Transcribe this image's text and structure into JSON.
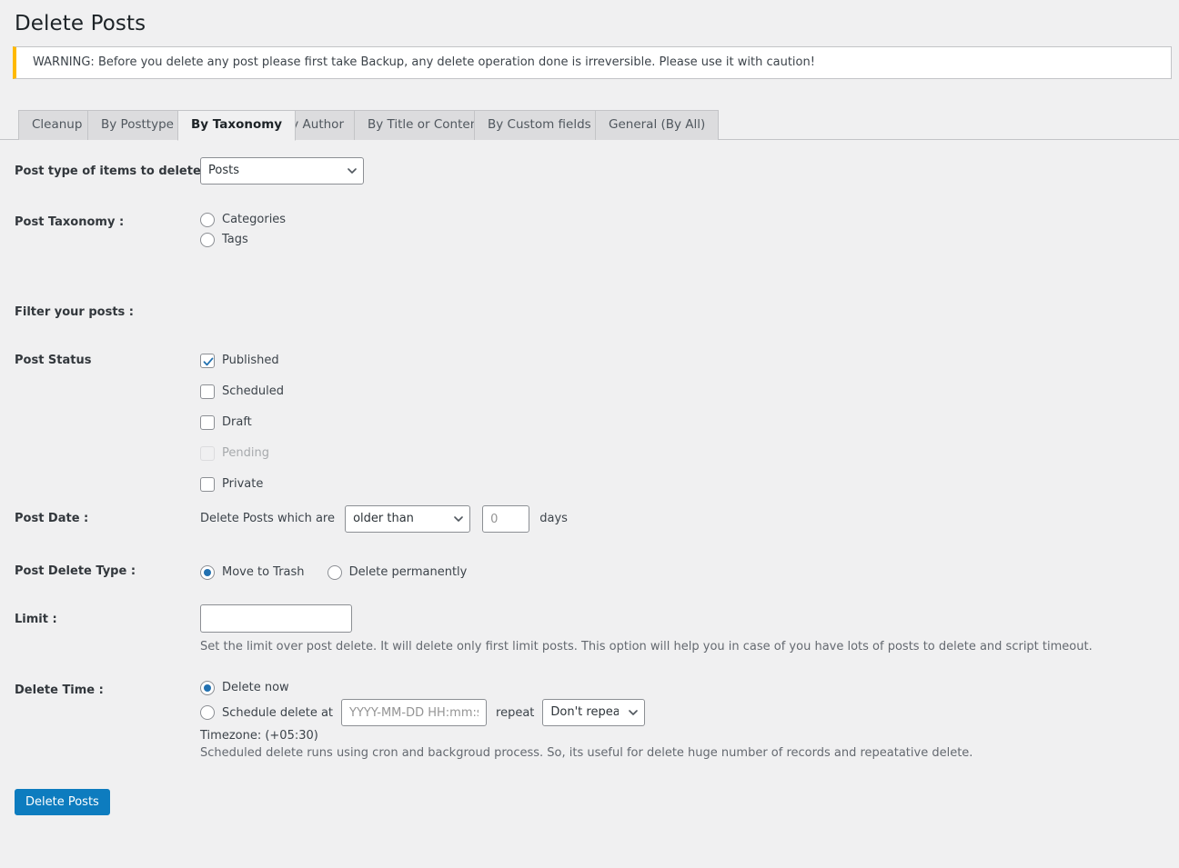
{
  "page": {
    "title": "Delete Posts"
  },
  "notice": {
    "text": "WARNING: Before you delete any post please first take Backup, any delete operation done is irreversible. Please use it with caution!",
    "accent_color": "#ffb900"
  },
  "tabs": {
    "items": [
      {
        "label": "Cleanup",
        "active": false
      },
      {
        "label": "By Posttype",
        "active": false
      },
      {
        "label": "By Taxonomy",
        "active": true
      },
      {
        "label": "By Author",
        "active": false
      },
      {
        "label": "By Title or Content",
        "active": false
      },
      {
        "label": "By Custom fields",
        "active": false
      },
      {
        "label": "General (By All)",
        "active": false
      }
    ]
  },
  "form": {
    "post_type": {
      "label": "Post type of items to delete :",
      "value": "Posts",
      "options": [
        "Posts"
      ]
    },
    "taxonomy": {
      "label": "Post Taxonomy :",
      "options": [
        {
          "label": "Categories",
          "checked": false
        },
        {
          "label": "Tags",
          "checked": false
        }
      ]
    },
    "filter_heading": "Filter your posts :",
    "post_status": {
      "label": "Post Status",
      "options": [
        {
          "label": "Published",
          "checked": true,
          "disabled": false
        },
        {
          "label": "Scheduled",
          "checked": false,
          "disabled": false
        },
        {
          "label": "Draft",
          "checked": false,
          "disabled": false
        },
        {
          "label": "Pending",
          "checked": false,
          "disabled": true
        },
        {
          "label": "Private",
          "checked": false,
          "disabled": false
        }
      ]
    },
    "post_date": {
      "label": "Post Date :",
      "prefix": "Delete Posts which are",
      "operator": "older than",
      "operator_options": [
        "older than"
      ],
      "days_placeholder": "0",
      "days_value": "",
      "suffix": "days"
    },
    "delete_type": {
      "label": "Post Delete Type :",
      "options": [
        {
          "label": "Move to Trash",
          "checked": true
        },
        {
          "label": "Delete permanently",
          "checked": false
        }
      ]
    },
    "limit": {
      "label": "Limit :",
      "value": "",
      "placeholder": "",
      "help": "Set the limit over post delete. It will delete only first limit posts. This option will help you in case of you have lots of posts to delete and script timeout."
    },
    "delete_time": {
      "label": "Delete Time :",
      "now_label": "Delete now",
      "now_checked": true,
      "schedule_label": "Schedule delete at",
      "schedule_checked": false,
      "schedule_placeholder": "YYYY-MM-DD HH:mm:ss",
      "schedule_value": "",
      "repeat_label": "repeat",
      "repeat_value": "Don't repeat",
      "repeat_options": [
        "Don't repeat"
      ],
      "timezone": "Timezone: (+05:30)",
      "help": "Scheduled delete runs using cron and backgroud process. So, its useful for delete huge number of records and repeatative delete."
    },
    "submit": {
      "label": "Delete Posts",
      "color": "#0d7cbf"
    }
  }
}
